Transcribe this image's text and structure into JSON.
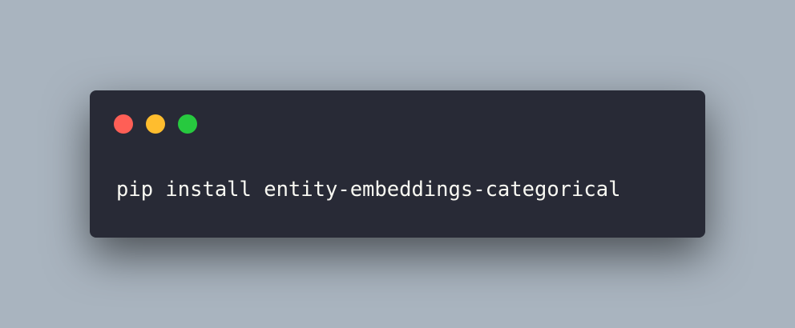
{
  "window": {
    "controls": [
      {
        "name": "close",
        "color": "#ff5f56"
      },
      {
        "name": "minimize",
        "color": "#ffbd2e"
      },
      {
        "name": "maximize",
        "color": "#27c93f"
      }
    ]
  },
  "code": {
    "text": "pip install entity-embeddings-categorical"
  },
  "colors": {
    "background": "#a9b4bf",
    "window": "#282a36",
    "text": "#f8f8f2"
  }
}
